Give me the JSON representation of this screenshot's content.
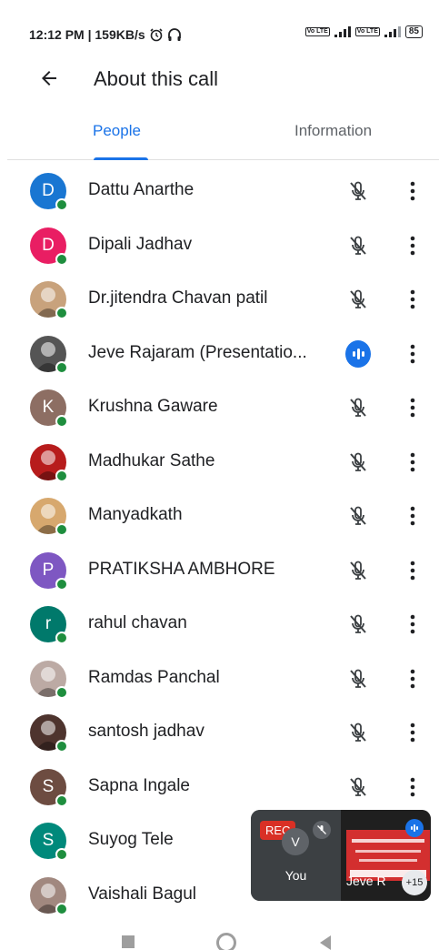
{
  "status_bar": {
    "time_speed": "12:12 PM | 159KB/s",
    "alarm_icon": "alarm-icon",
    "headset_icon": "headset-icon",
    "volte1": "Vo LTE",
    "volte2": "Vo LTE",
    "battery": "85"
  },
  "header": {
    "title": "About this call",
    "back_icon": "arrow-back-icon"
  },
  "tabs": [
    {
      "label": "People",
      "active": true
    },
    {
      "label": "Information",
      "active": false
    }
  ],
  "participants": [
    {
      "name": "Dattu Anarthe",
      "initial": "D",
      "avatar_color": "#1976d2",
      "status": "muted"
    },
    {
      "name": "Dipali Jadhav",
      "initial": "D",
      "avatar_color": "#e91e63",
      "status": "muted"
    },
    {
      "name": "Dr.jitendra Chavan patil",
      "initial": "",
      "avatar_color": "#c8a27c",
      "status": "muted"
    },
    {
      "name": "Jeve Rajaram (Presentatio...",
      "initial": "",
      "avatar_color": "#555555",
      "status": "speaking"
    },
    {
      "name": "Krushna Gaware",
      "initial": "K",
      "avatar_color": "#8d6e63",
      "status": "muted"
    },
    {
      "name": "Madhukar Sathe",
      "initial": "",
      "avatar_color": "#b71c1c",
      "status": "muted"
    },
    {
      "name": "Manyadkath",
      "initial": "",
      "avatar_color": "#d7a86e",
      "status": "muted"
    },
    {
      "name": "PRATIKSHA AMBHORE",
      "initial": "P",
      "avatar_color": "#7e57c2",
      "status": "muted"
    },
    {
      "name": "rahul chavan",
      "initial": "r",
      "avatar_color": "#00796b",
      "status": "muted"
    },
    {
      "name": "Ramdas Panchal",
      "initial": "",
      "avatar_color": "#bcaaa4",
      "status": "muted"
    },
    {
      "name": "santosh jadhav",
      "initial": "",
      "avatar_color": "#4e342e",
      "status": "muted"
    },
    {
      "name": "Sapna Ingale",
      "initial": "S",
      "avatar_color": "#6d4c41",
      "status": "muted"
    },
    {
      "name": "Suyog Tele",
      "initial": "S",
      "avatar_color": "#00897b",
      "status": "none"
    },
    {
      "name": "Vaishali Bagul",
      "initial": "",
      "avatar_color": "#a1887f",
      "status": "none"
    }
  ],
  "pip": {
    "rec_label": "REC",
    "you_initial": "V",
    "you_label": "You",
    "other_label": "Jeve R",
    "count_label": "+15"
  },
  "colors": {
    "accent": "#1a73e8",
    "online": "#1e8e3e",
    "rec": "#d93025"
  }
}
